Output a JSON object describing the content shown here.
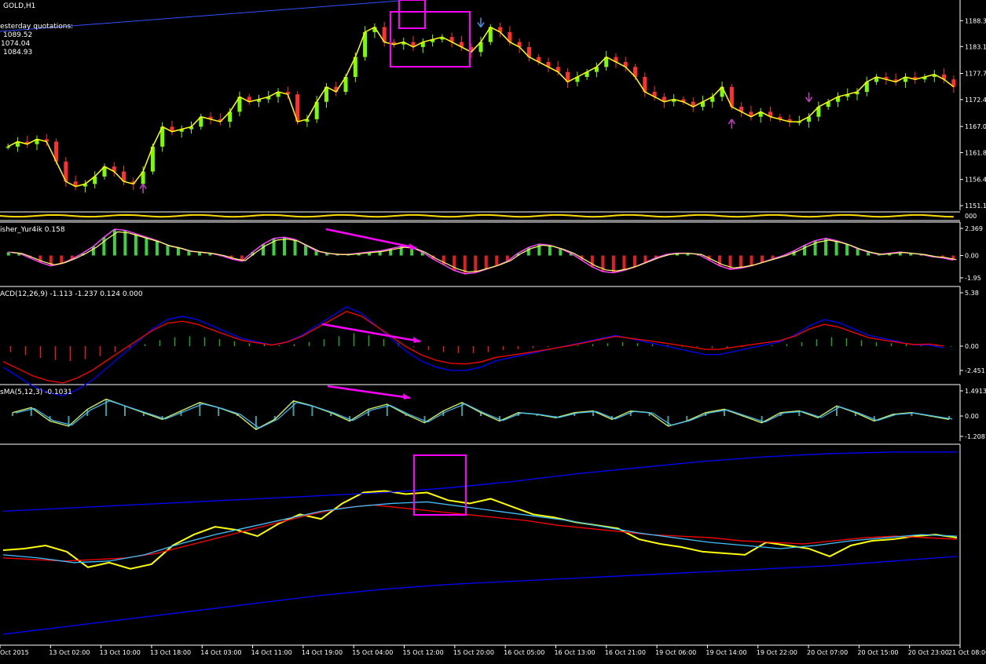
{
  "chart_title": "GOLD,H1",
  "yesterday_label": "esterday quotations:",
  "yesterday_values": [
    "1089.52",
    "1074.04",
    "1084.93"
  ],
  "colors": {
    "background": "#000000",
    "bull_candle": "#7cfc00",
    "bear_candle": "#ff3030",
    "price_line": "#ffff00",
    "fisher_line": "#ff44ff",
    "signal_line": "#ffff66",
    "macd_line": "#0000ff",
    "signal_red": "#ff0000",
    "osma_cyan": "#40c0ff",
    "highlight_box": "#ff00ff",
    "arrow_up": "#c040c0",
    "arrow_down_blue": "#4a90e2"
  },
  "chart_data": [
    {
      "type": "candlestick",
      "symbol": "GOLD",
      "timeframe": "H1",
      "y_ticks": [
        "1188.30",
        "1183.10",
        "1177.70",
        "1172.45",
        "1167.05",
        "1161.80",
        "1156.40",
        "1151.15"
      ],
      "ylim": [
        1151.15,
        1191.5
      ],
      "close_path": [
        1163,
        1164,
        1163.5,
        1164.5,
        1164,
        1160,
        1156,
        1155,
        1155.5,
        1157,
        1159,
        1158,
        1156,
        1155.5,
        1158,
        1163,
        1167,
        1166,
        1166.5,
        1167,
        1169,
        1168.5,
        1168,
        1170,
        1173,
        1172,
        1172.5,
        1173,
        1174,
        1173.5,
        1168,
        1168.5,
        1172,
        1175,
        1174,
        1177,
        1181,
        1186,
        1187,
        1184,
        1183.5,
        1184,
        1183,
        1184,
        1184.5,
        1185,
        1184,
        1183,
        1182,
        1184,
        1187,
        1186,
        1184,
        1183,
        1181,
        1180,
        1179,
        1178,
        1176,
        1177,
        1178,
        1179,
        1181,
        1180,
        1179,
        1177,
        1174,
        1173,
        1172,
        1172.5,
        1172,
        1171,
        1172,
        1173,
        1175,
        1171,
        1170,
        1169,
        1170,
        1169,
        1168.5,
        1168,
        1168,
        1169,
        1171,
        1172,
        1173,
        1173.5,
        1174,
        1176,
        1177,
        1176.5,
        1176,
        1177,
        1176.5,
        1177,
        1177.5,
        1176.5,
        1175
      ],
      "arrows": [
        {
          "kind": "up",
          "color": "#c040c0",
          "at_index": 14
        },
        {
          "kind": "down",
          "color": "#4a90e2",
          "at_index": 49
        },
        {
          "kind": "down",
          "color": "#c040c0",
          "at_index": 83
        },
        {
          "kind": "up",
          "color": "#c040c0",
          "at_index": 75
        }
      ]
    },
    {
      "type": "bar",
      "name": "Fisher_Yur4ik",
      "label": "isher_Yur4ik 0.158",
      "y_ticks": [
        "2.369",
        "0.00",
        "-1.95"
      ],
      "ylim": [
        -1.95,
        2.369
      ],
      "values": [
        0.3,
        0.2,
        -0.2,
        -0.6,
        -0.9,
        -0.7,
        -0.3,
        0.2,
        0.8,
        1.6,
        2.3,
        2.2,
        1.9,
        1.6,
        1.3,
        0.9,
        0.7,
        0.4,
        0.3,
        0.2,
        0.0,
        -0.3,
        -0.5,
        0.3,
        1.0,
        1.5,
        1.6,
        1.4,
        0.9,
        0.4,
        0.2,
        0.1,
        0.1,
        0.2,
        0.3,
        0.4,
        0.6,
        0.8,
        0.7,
        0.3,
        -0.3,
        -0.8,
        -1.3,
        -1.6,
        -1.5,
        -1.2,
        -0.9,
        -0.5,
        0.2,
        0.7,
        1.0,
        0.9,
        0.6,
        0.2,
        -0.4,
        -1.0,
        -1.4,
        -1.5,
        -1.3,
        -1.0,
        -0.6,
        -0.2,
        0.1,
        0.2,
        0.2,
        0.1,
        -0.4,
        -0.9,
        -1.2,
        -1.1,
        -0.9,
        -0.6,
        -0.3,
        0.0,
        0.4,
        0.9,
        1.3,
        1.5,
        1.3,
        1.0,
        0.6,
        0.3,
        0.1,
        0.2,
        0.3,
        0.2,
        0.1,
        -0.1,
        -0.2,
        -0.4
      ]
    },
    {
      "type": "bar",
      "name": "MACD",
      "label": "ACD(12,26,9) -1.113 -1.237 0.124 0.000",
      "y_ticks": [
        "5.38",
        "0.00",
        "-2.451"
      ],
      "ylim": [
        -2.451,
        5.38
      ],
      "values": [
        -0.6,
        -0.9,
        -1.2,
        -1.4,
        -1.5,
        -1.3,
        -1.0,
        -0.6,
        -0.2,
        0.2,
        0.6,
        0.9,
        1.0,
        0.9,
        0.7,
        0.5,
        0.3,
        0.2,
        0.1,
        0.2,
        0.4,
        0.7,
        1.0,
        1.3,
        1.1,
        0.7,
        0.3,
        -0.1,
        -0.4,
        -0.6,
        -0.7,
        -0.7,
        -0.6,
        -0.4,
        -0.3,
        -0.2,
        -0.1,
        0.0,
        0.1,
        0.2,
        0.3,
        0.4,
        0.3,
        0.2,
        0.1,
        0.0,
        -0.1,
        -0.2,
        -0.2,
        -0.1,
        0.0,
        0.1,
        0.2,
        0.4,
        0.7,
        0.9,
        0.8,
        0.6,
        0.4,
        0.3,
        0.2,
        0.1,
        0.1,
        0.0
      ]
    },
    {
      "type": "bar",
      "name": "OsMA",
      "label": "sMA(5,12,3) -0.1031",
      "y_ticks": [
        "1.4913",
        "0.00",
        "-1.2087"
      ],
      "ylim": [
        -1.2087,
        1.4913
      ],
      "values": [
        0.2,
        0.5,
        -0.3,
        -0.6,
        0.4,
        1.0,
        0.6,
        0.2,
        -0.2,
        0.3,
        0.8,
        0.5,
        0.1,
        -0.8,
        -0.2,
        0.9,
        0.6,
        0.2,
        -0.3,
        0.4,
        0.7,
        0.1,
        -0.4,
        0.3,
        0.8,
        0.2,
        -0.3,
        0.2,
        0.1,
        -0.1,
        0.2,
        0.3,
        -0.2,
        0.3,
        0.2,
        -0.6,
        -0.3,
        0.2,
        0.4,
        0.0,
        -0.4,
        0.2,
        0.3,
        -0.1,
        0.6,
        0.2,
        -0.3,
        0.1,
        0.2,
        0.0,
        -0.2
      ]
    },
    {
      "type": "line",
      "name": "moving-averages",
      "series": [
        {
          "color": "#ffff00",
          "values": [
            -0.1,
            0.0,
            0.2,
            -0.2,
            -1.2,
            -0.9,
            -1.3,
            -1.0,
            0.2,
            0.9,
            1.4,
            1.2,
            0.8,
            1.6,
            2.2,
            1.9,
            2.9,
            3.6,
            3.7,
            3.5,
            3.6,
            3.1,
            2.9,
            3.2,
            2.7,
            2.2,
            2.0,
            1.7,
            1.5,
            1.3,
            0.6,
            0.3,
            0.1,
            -0.2,
            -0.3,
            -0.4,
            0.4,
            0.2,
            0.0,
            -0.5,
            0.2,
            0.5,
            0.6,
            0.8,
            0.9,
            0.7
          ]
        },
        {
          "color": "#ff0000",
          "values": [
            -0.6,
            -0.7,
            -0.8,
            -0.7,
            -0.6,
            -0.3,
            0.2,
            0.7,
            1.2,
            1.7,
            2.2,
            2.6,
            2.8,
            2.6,
            2.4,
            2.2,
            2.0,
            1.8,
            1.5,
            1.3,
            1.1,
            0.9,
            0.8,
            0.7,
            0.5,
            0.4,
            0.3,
            0.5,
            0.7,
            0.8,
            0.7,
            0.6
          ]
        },
        {
          "color": "#40c0ff",
          "values": [
            -0.4,
            -0.6,
            -0.9,
            -0.8,
            -0.4,
            0.3,
            0.9,
            1.4,
            1.9,
            2.4,
            2.7,
            2.9,
            3.0,
            2.7,
            2.4,
            2.1,
            1.8,
            1.4,
            1.0,
            0.7,
            0.4,
            0.2,
            0.0,
            0.2,
            0.5,
            0.7,
            0.9,
            0.8
          ]
        },
        {
          "color": "#0000ff",
          "values": [
            2.4,
            2.6,
            2.8,
            3.0,
            3.2,
            3.4,
            3.6,
            3.9,
            4.3,
            4.8,
            5.2,
            5.6,
            5.9,
            6.1,
            6.2,
            6.2
          ]
        },
        {
          "color": "#0000ff",
          "values": [
            -5.5,
            -5.0,
            -4.5,
            -4.0,
            -3.5,
            -3.0,
            -2.6,
            -2.3,
            -2.1,
            -1.9,
            -1.7,
            -1.5,
            -1.3,
            -1.1,
            -0.8,
            -0.5
          ]
        }
      ]
    }
  ],
  "x_tick_labels": [
    "Oct 2015",
    "13 Oct 02:00",
    "13 Oct 10:00",
    "13 Oct 18:00",
    "14 Oct 03:00",
    "14 Oct 11:00",
    "14 Oct 19:00",
    "15 Oct 04:00",
    "15 Oct 12:00",
    "15 Oct 20:00",
    "16 Oct 05:00",
    "16 Oct 13:00",
    "16 Oct 21:00",
    "19 Oct 06:00",
    "19 Oct 14:00",
    "19 Oct 22:00",
    "20 Oct 07:00",
    "20 Oct 15:00",
    "20 Oct 23:00",
    "21 Oct 08:00"
  ]
}
